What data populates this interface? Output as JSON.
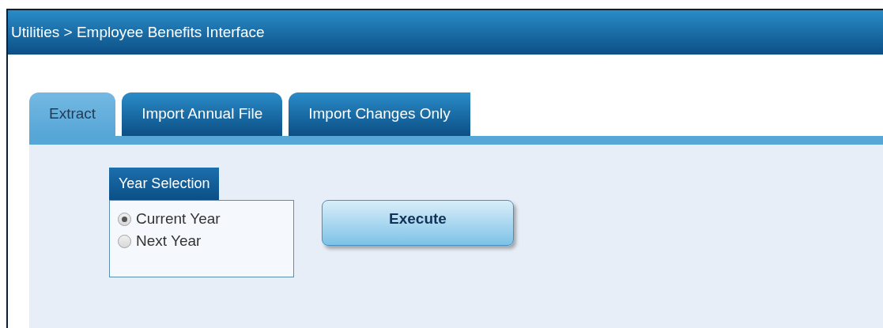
{
  "window": {
    "title": "Utilities > Employee Benefits Interface"
  },
  "tabs": [
    {
      "label": "Extract",
      "selected": true
    },
    {
      "label": "Import Annual File",
      "selected": false
    },
    {
      "label": "Import Changes Only",
      "selected": false
    }
  ],
  "year_selection": {
    "title": "Year Selection",
    "options": [
      {
        "label": "Current Year",
        "selected": true
      },
      {
        "label": "Next Year",
        "selected": false
      }
    ]
  },
  "execute_button": {
    "label": "Execute"
  }
}
